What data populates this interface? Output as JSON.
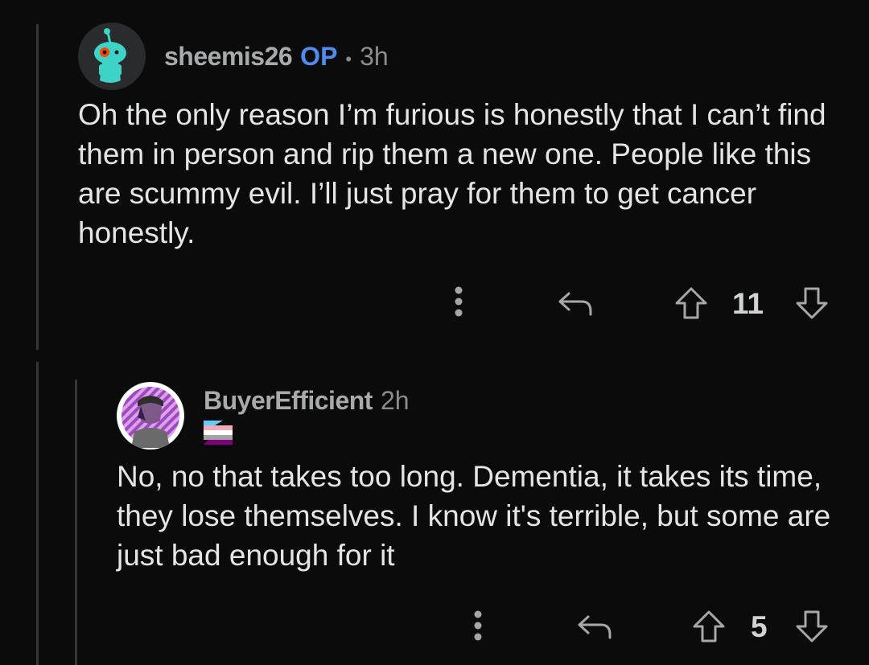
{
  "comments": [
    {
      "username": "sheemis26",
      "op_badge": "OP",
      "separator": "•",
      "time": "3h",
      "avatar_icon": "reddit-snoo-icon",
      "text": "Oh the only reason I’m furious is honestly that I can’t find them in person and rip them a new one. People like this are scummy evil. I’ll just pray for them to get cancer honestly.",
      "score": "11"
    },
    {
      "username": "BuyerEfficient",
      "time": "2h",
      "avatar_icon": "anime-character-avatar",
      "flair_icon": "pride-flag-icon",
      "text": "No, no that takes too long. Dementia, it takes its time, they lose themselves. I know it's terrible, but some are just bad enough for it",
      "score": "5"
    }
  ],
  "colors": {
    "background": "#0b0b0b",
    "op_badge": "#4f8cf0",
    "snoo": "#3dd3c6"
  }
}
